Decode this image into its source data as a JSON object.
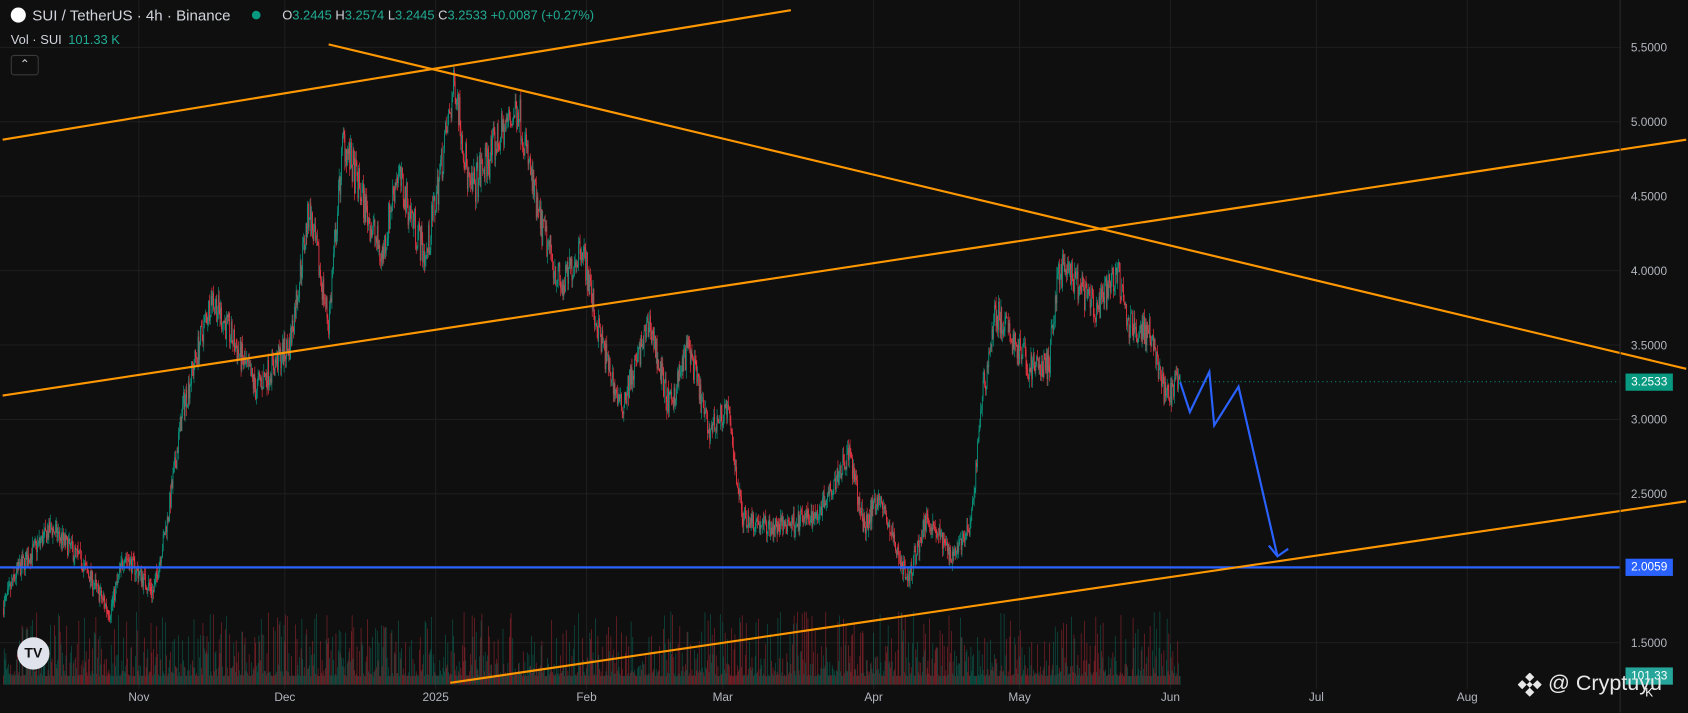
{
  "header": {
    "symbol": "SUI / TetherUS · 4h · Binance",
    "open_label": "O",
    "open": "3.2445",
    "high_label": "H",
    "high": "3.2574",
    "low_label": "L",
    "low": "3.2445",
    "close_label": "C",
    "close": "3.2533",
    "change": "+0.0087 (+0.27%)"
  },
  "volume": {
    "label": "Vol · SUI",
    "value": "101.33 K"
  },
  "collapse_icon": "chevron-up-icon",
  "watermark": {
    "text": "@ Cryptuyu",
    "icon": "binance-icon"
  },
  "tv_logo": "TV",
  "colors": {
    "background": "#0f0f0f",
    "up": "#089981",
    "down": "#f23645",
    "trendline": "#ff9800",
    "support": "#2962ff",
    "projection": "#2962ff"
  },
  "chart_data": {
    "type": "candlestick",
    "timeframe": "4h",
    "y_ticks": [
      "5.5000",
      "5.0000",
      "4.5000",
      "4.0000",
      "3.5000",
      "3.0000",
      "2.5000",
      "2.0000",
      "1.5000"
    ],
    "ylim": [
      1.2,
      5.85
    ],
    "x_ticks": [
      "Nov",
      "Dec",
      "2025",
      "Feb",
      "Mar",
      "Apr",
      "May",
      "Jun",
      "Jul",
      "Aug"
    ],
    "x_tick_dates": [
      "2024-11-01",
      "2024-12-01",
      "2025-01-01",
      "2025-02-01",
      "2025-03-01",
      "2025-04-01",
      "2025-05-01",
      "2025-06-01",
      "2025-07-01",
      "2025-08-01"
    ],
    "price_path": [
      [
        "2024-10-04",
        1.73
      ],
      [
        "2024-10-07",
        1.98
      ],
      [
        "2024-10-14",
        2.27
      ],
      [
        "2024-10-20",
        2.06
      ],
      [
        "2024-10-26",
        1.7
      ],
      [
        "2024-10-29",
        2.09
      ],
      [
        "2024-11-04",
        1.84
      ],
      [
        "2024-11-07",
        2.35
      ],
      [
        "2024-11-10",
        3.07
      ],
      [
        "2024-11-16",
        3.83
      ],
      [
        "2024-11-25",
        3.21
      ],
      [
        "2024-12-02",
        3.5
      ],
      [
        "2024-12-06",
        4.41
      ],
      [
        "2024-12-10",
        3.65
      ],
      [
        "2024-12-13",
        4.88
      ],
      [
        "2024-12-21",
        4.08
      ],
      [
        "2024-12-24",
        4.66
      ],
      [
        "2024-12-30",
        4.08
      ],
      [
        "2025-01-05",
        5.28
      ],
      [
        "2025-01-08",
        4.52
      ],
      [
        "2025-01-15",
        4.95
      ],
      [
        "2025-01-18",
        5.1
      ],
      [
        "2025-01-22",
        4.37
      ],
      [
        "2025-01-27",
        3.87
      ],
      [
        "2025-01-31",
        4.19
      ],
      [
        "2025-02-03",
        3.65
      ],
      [
        "2025-02-08",
        3.07
      ],
      [
        "2025-02-14",
        3.65
      ],
      [
        "2025-02-18",
        3.07
      ],
      [
        "2025-02-22",
        3.5
      ],
      [
        "2025-02-26",
        2.92
      ],
      [
        "2025-03-02",
        3.07
      ],
      [
        "2025-03-05",
        2.35
      ],
      [
        "2025-03-11",
        2.27
      ],
      [
        "2025-03-20",
        2.35
      ],
      [
        "2025-03-27",
        2.78
      ],
      [
        "2025-03-30",
        2.27
      ],
      [
        "2025-04-02",
        2.49
      ],
      [
        "2025-04-08",
        1.91
      ],
      [
        "2025-04-12",
        2.35
      ],
      [
        "2025-04-17",
        2.09
      ],
      [
        "2025-04-21",
        2.27
      ],
      [
        "2025-04-23",
        3.07
      ],
      [
        "2025-04-26",
        3.72
      ],
      [
        "2025-05-03",
        3.36
      ],
      [
        "2025-05-07",
        3.36
      ],
      [
        "2025-05-09",
        4.01
      ],
      [
        "2025-05-12",
        3.94
      ],
      [
        "2025-05-17",
        3.72
      ],
      [
        "2025-05-21",
        4.01
      ],
      [
        "2025-05-23",
        3.65
      ],
      [
        "2025-05-28",
        3.58
      ],
      [
        "2025-05-31",
        3.14
      ],
      [
        "2025-06-03",
        3.2533
      ]
    ],
    "last_price": "3.2533",
    "last_volume": "101.33 K",
    "horizontal_line": {
      "price": 2.0059,
      "label": "2.0059"
    },
    "trendlines": [
      {
        "from": [
          "2024-10-04",
          4.88
        ],
        "to": [
          "2025-03-15",
          5.75
        ]
      },
      {
        "from": [
          "2024-12-10",
          5.52
        ],
        "to": [
          "2025-09-15",
          3.34
        ]
      },
      {
        "from": [
          "2024-10-04",
          3.16
        ],
        "to": [
          "2025-09-15",
          4.88
        ]
      },
      {
        "from": [
          "2025-01-04",
          1.23
        ],
        "to": [
          "2025-09-15",
          2.45
        ]
      }
    ],
    "projection": [
      [
        "2025-06-03",
        3.25
      ],
      [
        "2025-06-05",
        3.05
      ],
      [
        "2025-06-09",
        3.32
      ],
      [
        "2025-06-10",
        2.96
      ],
      [
        "2025-06-15",
        3.22
      ],
      [
        "2025-06-23",
        2.08
      ]
    ]
  }
}
